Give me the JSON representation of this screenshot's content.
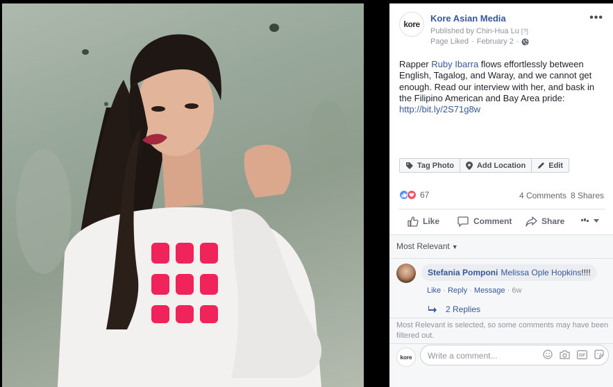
{
  "post": {
    "page_name": "Kore Asian Media",
    "logo_text": "kore",
    "published_by": "Published by Chin-Hua Lu",
    "help_mark": "[?]",
    "liked_status": "Page Liked",
    "separator": "·",
    "date": "February 2",
    "audience_icon": "globe-icon",
    "menu_icon": "more-options-icon",
    "text_before": "Rapper ",
    "mention": "Ruby Ibarra",
    "text_after": " flows effortlessly between English, Tagalog, and Waray, and we cannot get enough. Read our interview with her, and bask in the Filipino American and Bay Area pride:",
    "link": "http://bit.ly/2S71g8w"
  },
  "photo_tools": {
    "tag_photo": "Tag Photo",
    "add_location": "Add Location",
    "edit": "Edit"
  },
  "engagement": {
    "reaction_count": "67",
    "comments": "4 Comments",
    "shares": "8 Shares",
    "reaction_icons": [
      "like-reaction-icon",
      "love-reaction-icon"
    ]
  },
  "actions": {
    "like": "Like",
    "comment": "Comment",
    "share": "Share",
    "more_icon": "chevron-down-icon"
  },
  "comments": {
    "sort_label": "Most Relevant",
    "items": [
      {
        "author": "Stefania Pomponi",
        "mention": "Melissa Ople Hopkins",
        "text": "!!!!",
        "like": "Like",
        "reply": "Reply",
        "message": "Message",
        "time": "6w",
        "replies": "2 Replies"
      }
    ],
    "filter_note": "Most Relevant is selected, so some comments may have been filtered out.",
    "composer_placeholder": "Write a comment..."
  },
  "colors": {
    "link": "#365899",
    "meta_text": "#90949c",
    "panel_bg": "#ffffff",
    "comment_bg": "#f6f7f9",
    "sweater_print": "#f0245a"
  }
}
